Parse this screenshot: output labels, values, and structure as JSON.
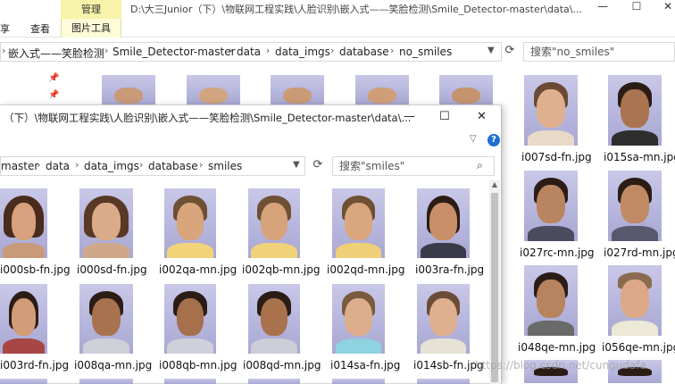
{
  "back_window": {
    "ribbon_tabs": {
      "share": "享",
      "view": "查看",
      "manage": "管理",
      "picture_tools": "图片工具"
    },
    "title": "D:\\大三Junior（下）\\物联网工程实践\\人脸识别\\嵌入式——笑脸检测\\Smile_Detector-master\\data\\...",
    "window_controls": {
      "minimize": "—",
      "maximize": "☐",
      "close": "✕"
    },
    "breadcrumbs": [
      "嵌入式——笑脸检测",
      "Smile_Detector-master",
      "data",
      "data_imgs",
      "database",
      "no_smiles"
    ],
    "search_placeholder": "搜索\"no_smiles\"",
    "files": [
      {
        "name": "i007sd-fn.jpg"
      },
      {
        "name": "i015sa-mn.jpg"
      },
      {
        "name": "i027rc-mn.jpg"
      },
      {
        "name": "i027rd-mn.jpg"
      },
      {
        "name": "i048qe-mn.jpg"
      },
      {
        "name": "i056qe-mn.jpg"
      }
    ]
  },
  "front_window": {
    "title": "（下）\\物联网工程实践\\人脸识别\\嵌入式——笑脸检测\\Smile_Detector-master\\data\\...",
    "window_controls": {
      "minimize": "—",
      "maximize": "☐",
      "close": "✕"
    },
    "help_label": "?",
    "breadcrumbs": [
      "master",
      "data",
      "data_imgs",
      "database",
      "smiles"
    ],
    "search_placeholder": "搜索\"smiles\"",
    "files": [
      {
        "name": "i000sb-fn.jpg"
      },
      {
        "name": "i000sd-fn.jpg"
      },
      {
        "name": "i002qa-mn.jpg"
      },
      {
        "name": "i002qb-mn.jpg"
      },
      {
        "name": "i002qd-mn.jpg"
      },
      {
        "name": "i003ra-fn.jpg"
      },
      {
        "name": "i003rd-fn.jpg"
      },
      {
        "name": "i008qa-mn.jpg"
      },
      {
        "name": "i008qb-mn.jpg"
      },
      {
        "name": "i008qd-mn.jpg"
      },
      {
        "name": "i014sa-fn.jpg"
      },
      {
        "name": "i014sb-fn.jpg"
      }
    ]
  },
  "watermark": "https://blog.csdn.net/cungudafa",
  "colors": {
    "manage_tab_bg": "#f7f3a8",
    "help_blue": "#1f6fd1",
    "photo_bg": "#b9b8de"
  }
}
